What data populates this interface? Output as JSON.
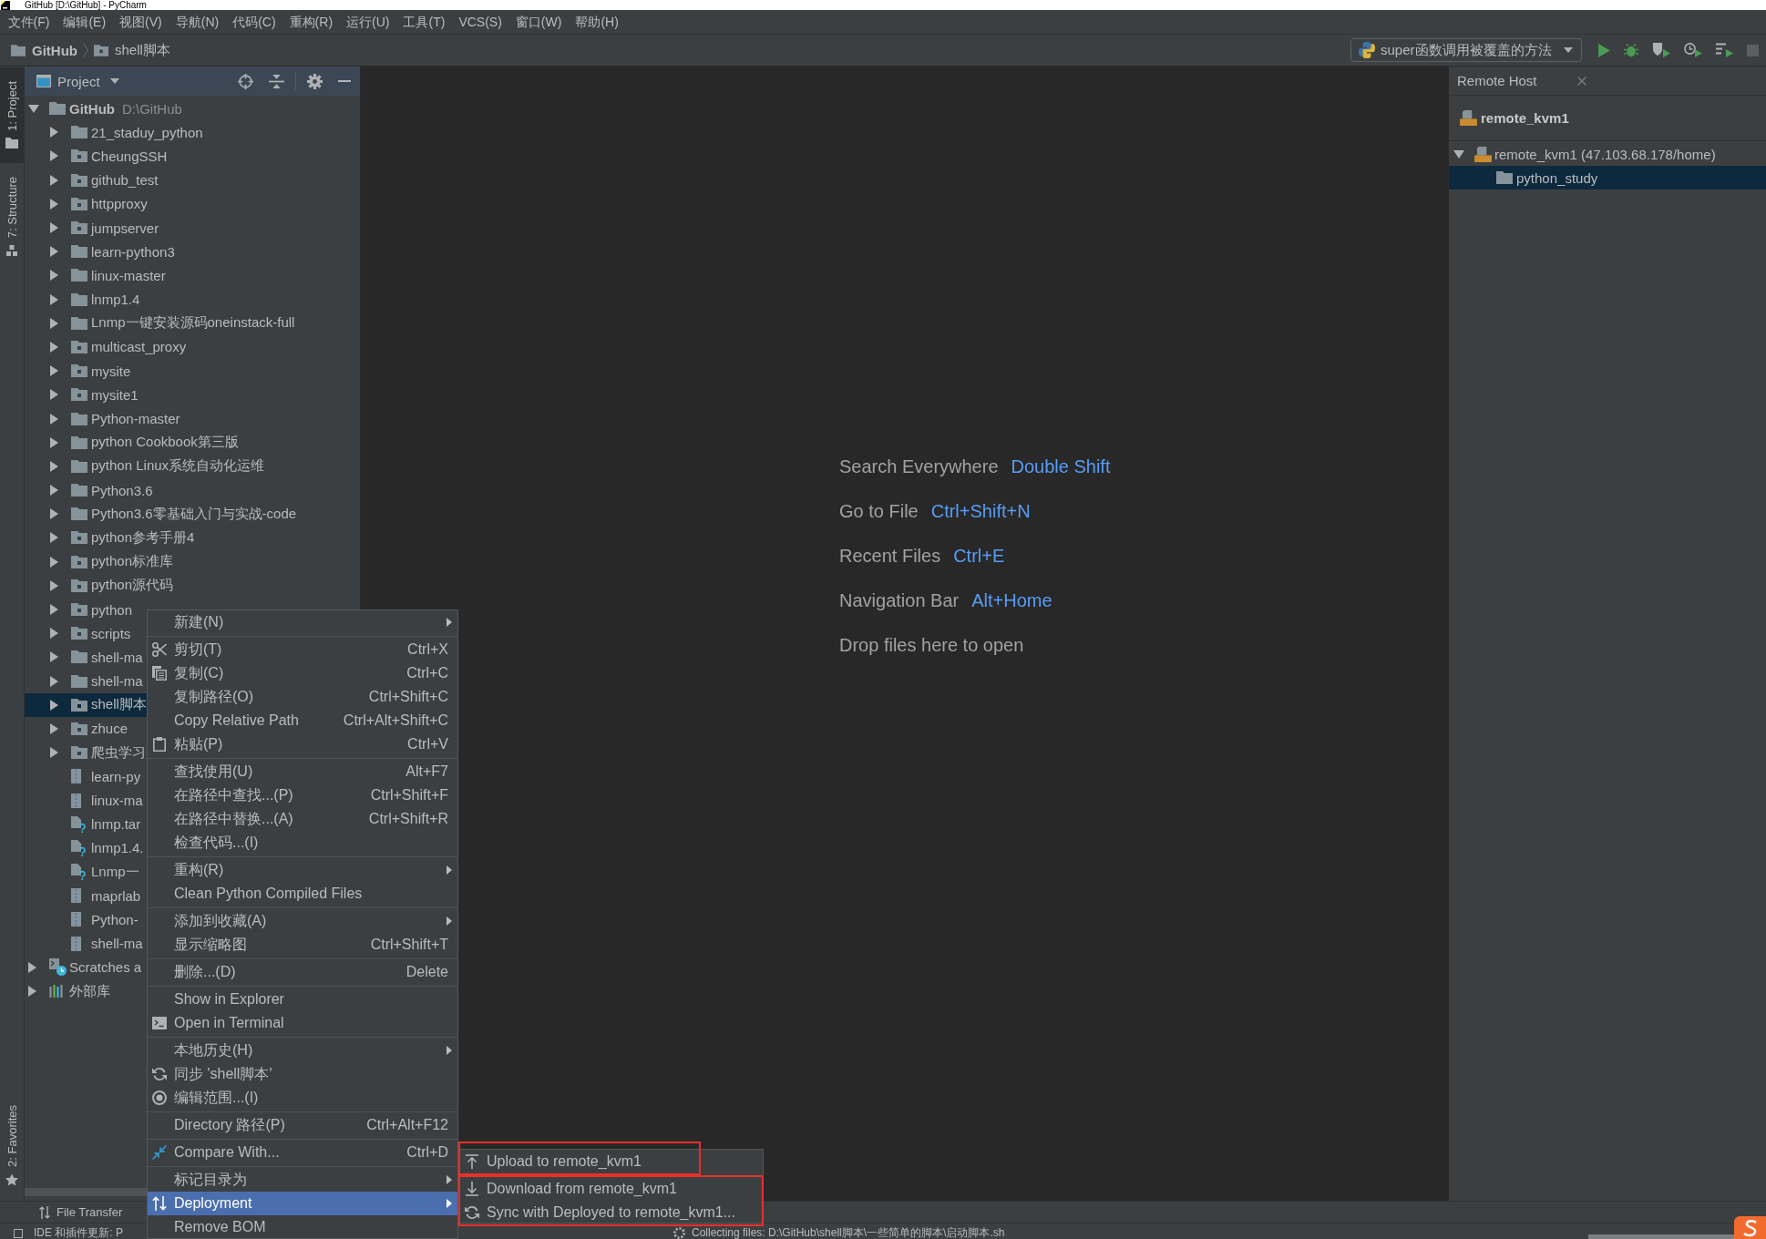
{
  "window": {
    "title": "GitHub [D:\\GitHub] - PyCharm"
  },
  "menu_bar": [
    "文件(F)",
    "编辑(E)",
    "视图(V)",
    "导航(N)",
    "代码(C)",
    "重构(R)",
    "运行(U)",
    "工具(T)",
    "VCS(S)",
    "窗口(W)",
    "帮助(H)"
  ],
  "breadcrumbs": [
    {
      "label": "GitHub",
      "kind": "folder"
    },
    {
      "label": "shell脚本",
      "kind": "package"
    }
  ],
  "run_configuration": {
    "label": "super函数调用被覆盖的方法"
  },
  "run_toolbar": [
    {
      "kind": "run",
      "disabled": false
    },
    {
      "kind": "debug",
      "disabled": false
    },
    {
      "kind": "coverage",
      "disabled": false
    },
    {
      "kind": "profile",
      "disabled": false
    },
    {
      "kind": "concurrency",
      "disabled": false
    },
    {
      "kind": "stop",
      "disabled": true
    }
  ],
  "left_stripe": {
    "top": [
      {
        "label": "1: Project",
        "kind": "project",
        "selected": true
      },
      {
        "label": "7: Structure",
        "kind": "structure",
        "selected": false
      }
    ],
    "bottom": [
      {
        "label": "2: Favorites",
        "kind": "favorites",
        "selected": false
      }
    ]
  },
  "project_panel": {
    "title": "Project",
    "tree": [
      {
        "label": "GitHub",
        "path": "D:\\GitHub",
        "kind": "root",
        "expanded": true,
        "selected": false,
        "children": [
          {
            "label": "21_staduy_python",
            "kind": "folder",
            "expanded": false,
            "selected": false
          },
          {
            "label": "CheungSSH",
            "kind": "package",
            "expanded": false,
            "selected": false
          },
          {
            "label": "github_test",
            "kind": "package",
            "expanded": false,
            "selected": false
          },
          {
            "label": "httpproxy",
            "kind": "package",
            "expanded": false,
            "selected": false
          },
          {
            "label": "jumpserver",
            "kind": "package",
            "expanded": false,
            "selected": false
          },
          {
            "label": "learn-python3",
            "kind": "folder",
            "expanded": false,
            "selected": false
          },
          {
            "label": "linux-master",
            "kind": "folder",
            "expanded": false,
            "selected": false
          },
          {
            "label": "lnmp1.4",
            "kind": "folder",
            "expanded": false,
            "selected": false
          },
          {
            "label": "Lnmp一键安装源码oneinstack-full",
            "kind": "folder",
            "expanded": false,
            "selected": false
          },
          {
            "label": "multicast_proxy",
            "kind": "package",
            "expanded": false,
            "selected": false
          },
          {
            "label": "mysite",
            "kind": "package",
            "expanded": false,
            "selected": false
          },
          {
            "label": "mysite1",
            "kind": "package",
            "expanded": false,
            "selected": false
          },
          {
            "label": "Python-master",
            "kind": "folder",
            "expanded": false,
            "selected": false
          },
          {
            "label": "python Cookbook第三版",
            "kind": "folder",
            "expanded": false,
            "selected": false
          },
          {
            "label": "python Linux系统自动化运维",
            "kind": "folder",
            "expanded": false,
            "selected": false
          },
          {
            "label": "Python3.6",
            "kind": "folder",
            "expanded": false,
            "selected": false
          },
          {
            "label": "Python3.6零基础入门与实战-code",
            "kind": "folder",
            "expanded": false,
            "selected": false
          },
          {
            "label": "python参考手册4",
            "kind": "package",
            "expanded": false,
            "selected": false
          },
          {
            "label": "python标准库",
            "kind": "package",
            "expanded": false,
            "selected": false
          },
          {
            "label": "python源代码",
            "kind": "package",
            "expanded": false,
            "selected": false
          },
          {
            "label": "python",
            "kind": "package",
            "expanded": false,
            "selected": false
          },
          {
            "label": "scripts",
            "kind": "package",
            "expanded": false,
            "selected": false
          },
          {
            "label": "shell-ma",
            "kind": "folder",
            "expanded": false,
            "selected": false
          },
          {
            "label": "shell-ma",
            "kind": "folder",
            "expanded": false,
            "selected": false
          },
          {
            "label": "shell脚本",
            "kind": "package",
            "expanded": false,
            "selected": true
          },
          {
            "label": "zhuce",
            "kind": "package",
            "expanded": false,
            "selected": false
          },
          {
            "label": "爬虫学习",
            "kind": "package",
            "expanded": false,
            "selected": false
          },
          {
            "label": "learn-py",
            "kind": "archive",
            "selected": false
          },
          {
            "label": "linux-ma",
            "kind": "archive",
            "selected": false
          },
          {
            "label": "lnmp.tar",
            "kind": "unknown",
            "selected": false
          },
          {
            "label": "lnmp1.4.",
            "kind": "unknown",
            "selected": false
          },
          {
            "label": "Lnmp一",
            "kind": "unknown",
            "selected": false
          },
          {
            "label": "maprlab",
            "kind": "archive",
            "selected": false
          },
          {
            "label": "Python-",
            "kind": "archive",
            "selected": false
          },
          {
            "label": "shell-ma",
            "kind": "archive",
            "selected": false
          }
        ]
      },
      {
        "label": "Scratches a",
        "kind": "scratches",
        "expanded": false,
        "selected": false
      },
      {
        "label": "外部库",
        "kind": "library",
        "expanded": false,
        "selected": false
      }
    ]
  },
  "editor": {
    "hints": [
      {
        "label": "Search Everywhere",
        "shortcut": "Double Shift"
      },
      {
        "label": "Go to File",
        "shortcut": "Ctrl+Shift+N"
      },
      {
        "label": "Recent Files",
        "shortcut": "Ctrl+E"
      },
      {
        "label": "Navigation Bar",
        "shortcut": "Alt+Home"
      },
      {
        "label": "Drop files here to open"
      }
    ]
  },
  "remote_host": {
    "title": "Remote Host",
    "server": "remote_kvm1",
    "tree": [
      {
        "label": "remote_kvm1 (47.103.68.178/home)",
        "kind": "server",
        "expanded": true,
        "selected": false,
        "children": [
          {
            "label": "python_study",
            "kind": "folder",
            "selected": true
          }
        ]
      }
    ]
  },
  "context_menu": {
    "sections": [
      {
        "items": [
          {
            "label": "新建(N)",
            "kind": "plain",
            "has_submenu": true,
            "selected": false
          }
        ]
      },
      {
        "items": [
          {
            "label": "剪切(T)",
            "shortcut": "Ctrl+X",
            "kind": "cut",
            "has_submenu": false,
            "selected": false
          },
          {
            "label": "复制(C)",
            "shortcut": "Ctrl+C",
            "kind": "copy",
            "has_submenu": false,
            "selected": false
          },
          {
            "label": "复制路径(O)",
            "shortcut": "Ctrl+Shift+C",
            "kind": "plain",
            "has_submenu": false,
            "selected": false
          },
          {
            "label": "Copy Relative Path",
            "shortcut": "Ctrl+Alt+Shift+C",
            "kind": "plain",
            "has_submenu": false,
            "selected": false
          },
          {
            "label": "粘贴(P)",
            "shortcut": "Ctrl+V",
            "kind": "paste",
            "has_submenu": false,
            "selected": false
          }
        ]
      },
      {
        "items": [
          {
            "label": "查找使用(U)",
            "shortcut": "Alt+F7",
            "kind": "plain",
            "has_submenu": false,
            "selected": false
          },
          {
            "label": "在路径中查找...(P)",
            "shortcut": "Ctrl+Shift+F",
            "kind": "plain",
            "has_submenu": false,
            "selected": false
          },
          {
            "label": "在路径中替换...(A)",
            "shortcut": "Ctrl+Shift+R",
            "kind": "plain",
            "has_submenu": false,
            "selected": false
          },
          {
            "label": "检查代码...(I)",
            "kind": "plain",
            "has_submenu": false,
            "selected": false
          }
        ]
      },
      {
        "items": [
          {
            "label": "重构(R)",
            "kind": "plain",
            "has_submenu": true,
            "selected": false
          },
          {
            "label": "Clean Python Compiled Files",
            "kind": "plain",
            "has_submenu": false,
            "selected": false
          }
        ]
      },
      {
        "items": [
          {
            "label": "添加到收藏(A)",
            "kind": "plain",
            "has_submenu": true,
            "selected": false
          },
          {
            "label": "显示缩略图",
            "shortcut": "Ctrl+Shift+T",
            "kind": "plain",
            "has_submenu": false,
            "selected": false
          }
        ]
      },
      {
        "items": [
          {
            "label": "删除...(D)",
            "shortcut": "Delete",
            "kind": "plain",
            "has_submenu": false,
            "selected": false
          }
        ]
      },
      {
        "items": [
          {
            "label": "Show in Explorer",
            "kind": "plain",
            "has_submenu": false,
            "selected": false
          },
          {
            "label": "Open in Terminal",
            "kind": "terminal",
            "has_submenu": false,
            "selected": false
          }
        ]
      },
      {
        "items": [
          {
            "label": "本地历史(H)",
            "kind": "plain",
            "has_submenu": true,
            "selected": false
          },
          {
            "label": "同步 'shell脚本'",
            "kind": "sync",
            "has_submenu": false,
            "selected": false
          },
          {
            "label": "编辑范围...(I)",
            "kind": "scope",
            "has_submenu": false,
            "selected": false
          }
        ]
      },
      {
        "items": [
          {
            "label": "Directory 路径(P)",
            "shortcut": "Ctrl+Alt+F12",
            "kind": "plain",
            "has_submenu": false,
            "selected": false
          }
        ]
      },
      {
        "items": [
          {
            "label": "Compare With...",
            "shortcut": "Ctrl+D",
            "kind": "compare",
            "has_submenu": false,
            "selected": false
          }
        ]
      },
      {
        "items": [
          {
            "label": "标记目录为",
            "kind": "plain",
            "has_submenu": true,
            "selected": false
          },
          {
            "label": "Deployment",
            "kind": "deploy",
            "has_submenu": true,
            "selected": true
          },
          {
            "label": "Remove BOM",
            "kind": "plain",
            "has_submenu": false,
            "selected": false
          }
        ]
      }
    ]
  },
  "deployment_submenu": {
    "groups": [
      {
        "framed": true,
        "items": [
          {
            "label": "Upload to remote_kvm1",
            "kind": "upload",
            "selected": false
          }
        ]
      },
      {
        "framed": true,
        "items": [
          {
            "label": "Download from remote_kvm1",
            "kind": "download",
            "selected": false
          },
          {
            "label": "Sync with Deployed to remote_kvm1...",
            "kind": "sync",
            "selected": false
          }
        ]
      }
    ]
  },
  "bottom_tool_bar": [
    {
      "label": "File Transfer",
      "selected": false
    }
  ],
  "status_bar": {
    "message": "IDE 和插件更新: P",
    "task": "Collecting files: D:\\GitHub\\shell脚本\\一些简单的脚本\\启动脚本.sh",
    "progress": {
      "level": 1
    }
  }
}
